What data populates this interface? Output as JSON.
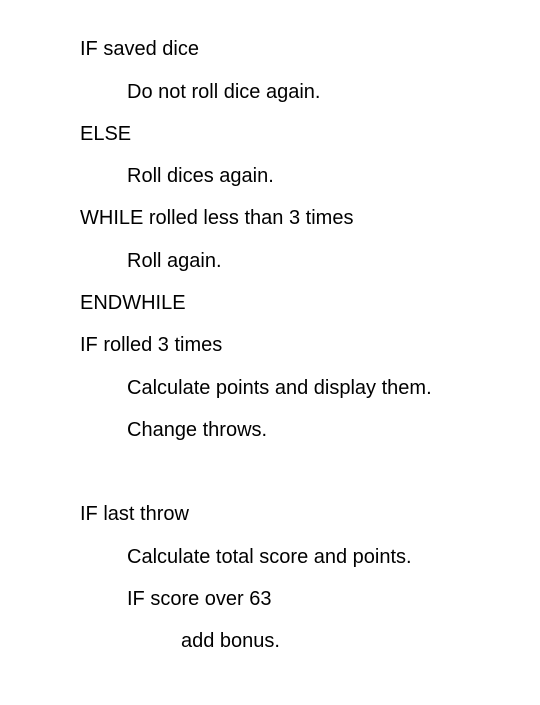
{
  "document": {
    "lines": [
      "IF saved dice",
      "Do not roll dice again.",
      "ELSE",
      "Roll dices again.",
      "WHILE rolled less than 3 times",
      "Roll again.",
      "ENDWHILE",
      "IF rolled 3 times",
      "Calculate points and display them.",
      "Change throws.",
      "IF last throw",
      "Calculate total score and points.",
      "IF score over 63",
      "add bonus."
    ]
  }
}
